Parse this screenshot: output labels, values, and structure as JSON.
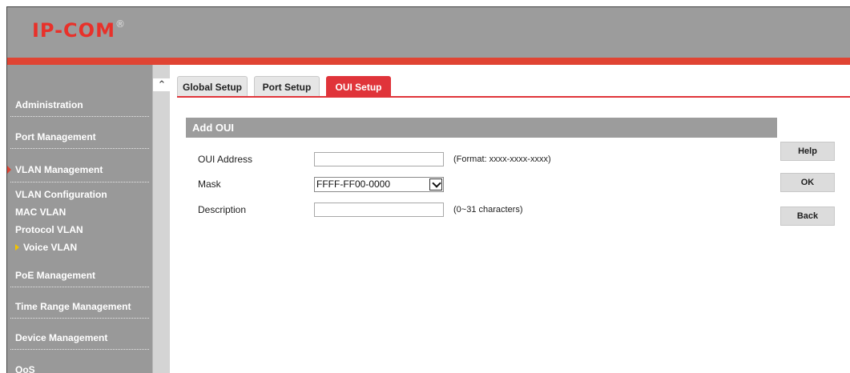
{
  "header": {
    "logo_text": "IP-COM",
    "logo_mark": "®"
  },
  "sidebar": {
    "items": [
      {
        "label": "Administration"
      },
      {
        "label": "Port Management"
      },
      {
        "label": "VLAN Management"
      },
      {
        "label": "PoE Management"
      },
      {
        "label": "Time Range Management"
      },
      {
        "label": "Device Management"
      },
      {
        "label": "QoS"
      }
    ],
    "subitems": [
      {
        "label": "VLAN Configuration"
      },
      {
        "label": "MAC VLAN"
      },
      {
        "label": "Protocol VLAN"
      },
      {
        "label": "Voice VLAN"
      }
    ]
  },
  "tabs": [
    {
      "label": "Global Setup"
    },
    {
      "label": "Port Setup"
    },
    {
      "label": "OUI Setup"
    }
  ],
  "panel": {
    "title": "Add OUI"
  },
  "form": {
    "oui_label": "OUI Address",
    "oui_value": "",
    "oui_hint": "(Format: xxxx-xxxx-xxxx)",
    "mask_label": "Mask",
    "mask_value": "FFFF-FF00-0000",
    "desc_label": "Description",
    "desc_value": "",
    "desc_hint": "(0~31 characters)"
  },
  "buttons": {
    "help": "Help",
    "ok": "OK",
    "back": "Back"
  },
  "colors": {
    "accent": "#e0343a",
    "header_gray": "#9c9c9c",
    "sidebar_gray": "#999999"
  }
}
